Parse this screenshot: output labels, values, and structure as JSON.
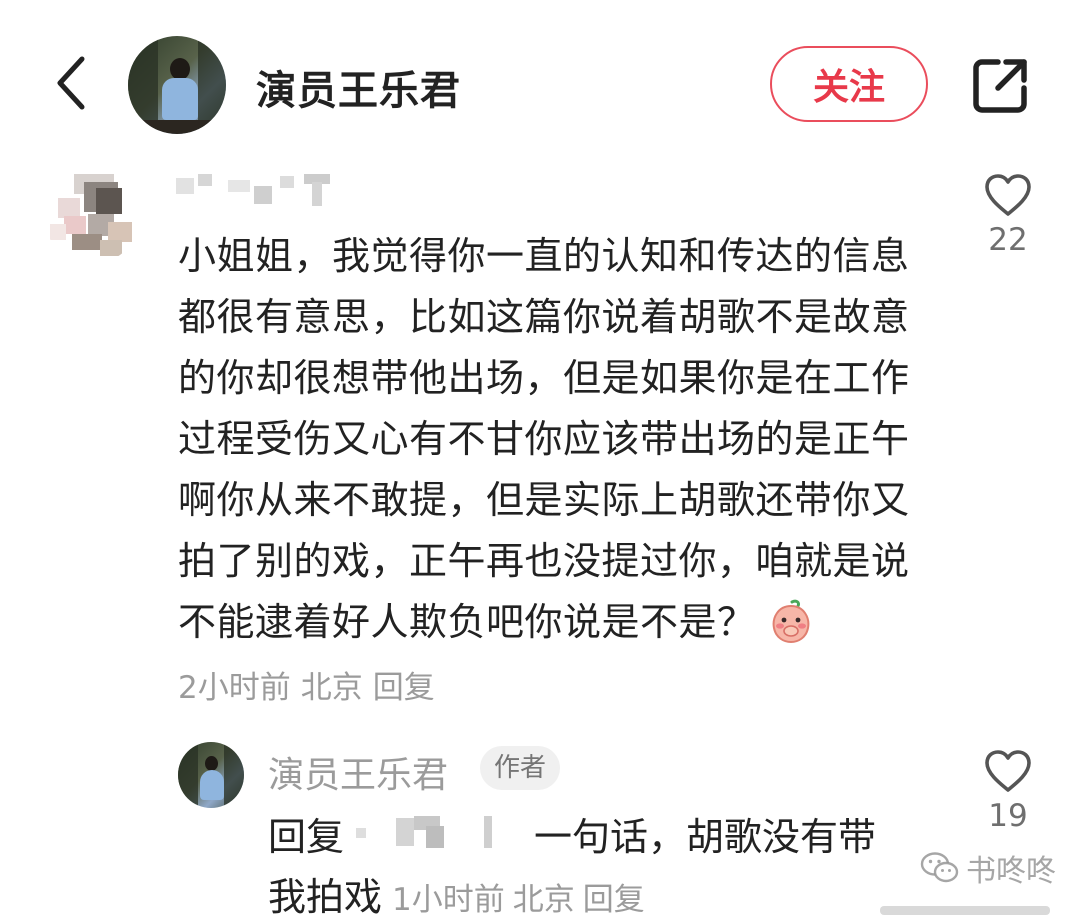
{
  "header": {
    "name": "演员王乐君",
    "follow_label": "关注"
  },
  "comment": {
    "text_lines": [
      "小姐姐，我觉得你一直的认知和传达的信息",
      "都很有意思，比如这篇你说着胡歌不是故意",
      "的你却很想带他出场，但是如果你是在工作",
      "过程受伤又心有不甘你应该带出场的是正午",
      "啊你从来不敢提，但是实际上胡歌还带你又",
      "拍了别的戏，正午再也没提过你，咱就是说",
      "不能逮着好人欺负吧你说是不是？"
    ],
    "time": "2小时前",
    "location": "北京",
    "reply_label": "回复",
    "likes": "22"
  },
  "reply": {
    "name": "演员王乐君",
    "author_badge": "作者",
    "prefix": "回复",
    "text_part1": "一句话，胡歌没有带",
    "text_part2": "我拍戏",
    "time": "1小时前",
    "location": "北京",
    "reply_label": "回复",
    "likes": "19"
  },
  "watermark": {
    "text": "书咚咚"
  },
  "colors": {
    "accent_red": "#e8394a",
    "meta_gray": "#9b9b9b",
    "text_dark": "#222222"
  },
  "icons": {
    "back": "chevron-left-icon",
    "share": "share-icon",
    "like": "heart-outline-icon",
    "emoji": "shy-peach-emoji-icon",
    "watermark": "wechat-icon"
  }
}
